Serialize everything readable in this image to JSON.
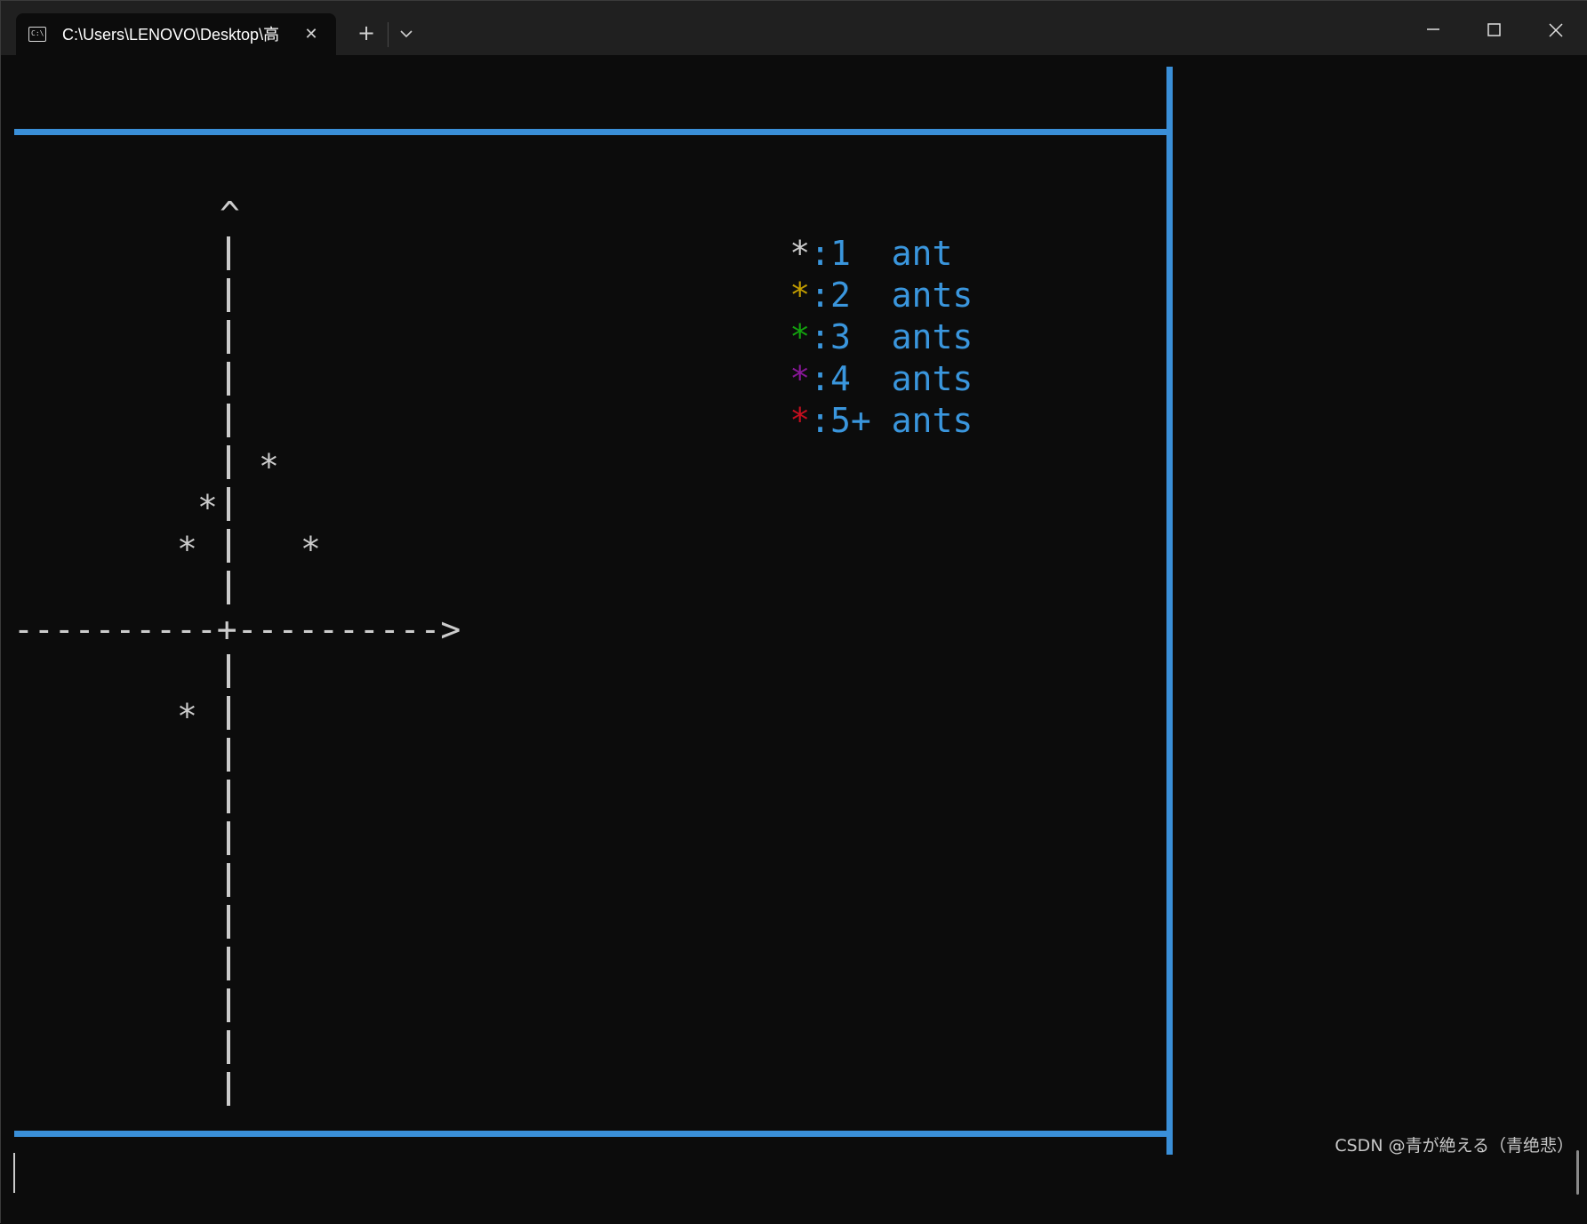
{
  "window": {
    "tab_title": "C:\\Users\\LENOVO\\Desktop\\高",
    "new_tab_label": "+",
    "close_tab_label": "✕"
  },
  "terminal": {
    "axis_arrow_up": "^",
    "axis_horizontal": "----------+---------->",
    "point_glyph": "*",
    "legend": [
      {
        "star": "*",
        "text": ":1  ant",
        "color": "#cccccc"
      },
      {
        "star": "*",
        "text": ":2  ants",
        "color": "#c19c00"
      },
      {
        "star": "*",
        "text": ":3  ants",
        "color": "#13a10e"
      },
      {
        "star": "*",
        "text": ":4  ants",
        "color": "#881798"
      },
      {
        "star": "*",
        "text": ":5+ ants",
        "color": "#c50f1f"
      }
    ],
    "frame_color": "#3a8fd8"
  },
  "watermark": "CSDN @青が絶える（青绝悲）"
}
